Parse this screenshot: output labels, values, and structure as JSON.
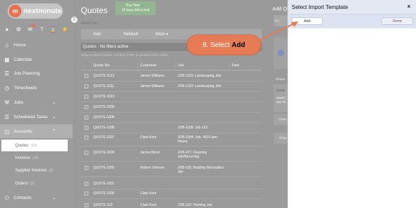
{
  "app": {
    "logo_letter": "m",
    "logo_text": "nextminute"
  },
  "top_icons": [
    "user-icon",
    "gear-icon",
    "mail-icon",
    "help-icon",
    "hourglass-icon",
    "bolt-icon"
  ],
  "sidebar": {
    "items": [
      {
        "label": "Home"
      },
      {
        "label": "Calendar"
      },
      {
        "label": "Job Planning"
      },
      {
        "label": "Timesheets"
      },
      {
        "label": "Jobs"
      },
      {
        "label": "Scheduled Tasks"
      },
      {
        "label": "Accounts"
      },
      {
        "label": "Contacts"
      }
    ],
    "subitems": [
      {
        "label": "Quotes",
        "count": "(15)"
      },
      {
        "label": "Invoices",
        "count": "(10)"
      },
      {
        "label": "Supplier Invoices",
        "count": "(2)"
      },
      {
        "label": "Orders",
        "count": "(2)"
      }
    ]
  },
  "main": {
    "title": "Quotes",
    "buy_now_line1": "Buy Now 🛒",
    "buy_now_line2": "15 days left in trial",
    "search_placeholder": "Search for...",
    "toolbar": {
      "add": "Add",
      "refresh": "Refresh",
      "more": "More ▾"
    },
    "filter_text": "Quotes - No filters active",
    "groupby_text": "Drag a column header and drop it here to group by that column",
    "columns": [
      "Quote No.",
      "Customer",
      "Job",
      "Task"
    ],
    "rows": [
      {
        "quote": "QUOTE-1012",
        "customer": "James Williams",
        "job": "JOB-1103: Landscaping Job",
        "job2": ""
      },
      {
        "quote": "QUOTE-1011",
        "customer": "James Williams",
        "job": "JOB-1103: Landscaping Job",
        "job2": ""
      },
      {
        "quote": "QUOTE-1010",
        "customer": "",
        "job": "",
        "job2": ""
      },
      {
        "quote": "QUOTE-1009",
        "customer": "",
        "job": "",
        "job2": ""
      },
      {
        "quote": "QUOTE-1008",
        "customer": "",
        "job": "",
        "job2": ""
      },
      {
        "quote": "QUOTE-1008",
        "customer": "",
        "job": "JOB-1008: Job 123",
        "job2": ""
      },
      {
        "quote": "QUOTE-1007",
        "customer": "Clark Kent",
        "job": "JOB-1004: Job- 450 Farm",
        "job2": "House"
      },
      {
        "quote": "QUOTE-1003",
        "customer": "James Bond",
        "job": "JOB-107: Cleaning",
        "job2": "Job/Recurring"
      },
      {
        "quote": "QUOTE-1002",
        "customer": "Robert Johnson",
        "job": "JOB-105: Building Renovation",
        "job2": "Job"
      },
      {
        "quote": "QUOTE-1001",
        "customer": "",
        "job": "",
        "job2": ""
      },
      {
        "quote": "QUOTE-1000",
        "customer": "Clark Kent",
        "job": "",
        "job2": ""
      },
      {
        "quote": "QUOTE-103",
        "customer": "Clark Kent",
        "job": "JOB-102: Planting Job",
        "job2": ""
      }
    ]
  },
  "right_panel": {
    "title": "Add Qu",
    "tab": "Ba",
    "choose1": "Choos",
    "quote_lbl": "Quote",
    "used1": "Used f",
    "used2": "any Es",
    "choose2": "Choo",
    "choose3": "Choo"
  },
  "dialog": {
    "title": "Select Import Template",
    "close": "×",
    "add": "Add",
    "done": "Done"
  },
  "callout": {
    "text": "8. Select",
    "bold": "Add"
  },
  "colors": {
    "accent": "#e8704f",
    "callout": "#e57c56",
    "dialog_header": "#e3e8f3"
  }
}
